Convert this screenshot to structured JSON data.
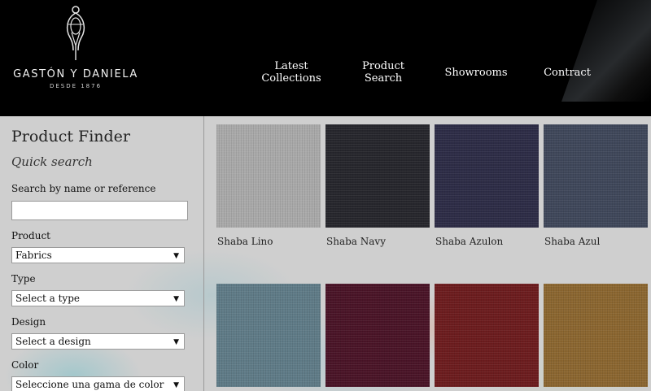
{
  "brand": {
    "name": "GASTÓN Y DANIELA",
    "since": "DESDE 1876"
  },
  "nav": [
    {
      "label": "Latest\nCollections"
    },
    {
      "label": "Product\nSearch"
    },
    {
      "label": "Showrooms"
    },
    {
      "label": "Contract"
    }
  ],
  "sidebar": {
    "title": "Product Finder",
    "subtitle": "Quick search",
    "search_label": "Search by name or reference",
    "search_value": "",
    "product_label": "Product",
    "product_value": "Fabrics",
    "type_label": "Type",
    "type_value": "Select a type",
    "design_label": "Design",
    "design_value": "Select a design",
    "color_label": "Color",
    "color_value": "Seleccione una gama de color"
  },
  "products": [
    {
      "name": "Shaba Lino",
      "color": "#a9a9a9"
    },
    {
      "name": "Shaba Navy",
      "color": "#26262c"
    },
    {
      "name": "Shaba Azulon",
      "color": "#2d2c46"
    },
    {
      "name": "Shaba Azul",
      "color": "#3f475a"
    },
    {
      "name": "",
      "color": "#5f7b87"
    },
    {
      "name": "",
      "color": "#4a1427"
    },
    {
      "name": "",
      "color": "#6c1c1e"
    },
    {
      "name": "",
      "color": "#8b6630"
    }
  ]
}
